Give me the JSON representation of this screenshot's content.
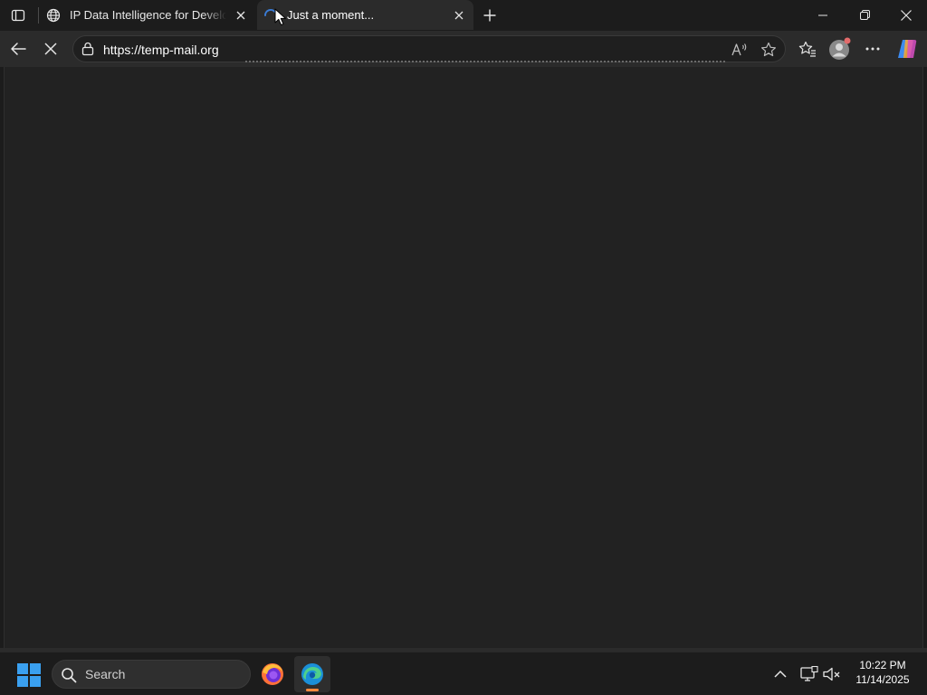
{
  "browser": {
    "tabs": [
      {
        "title": "IP Data Intelligence for Developers",
        "icon": "globe-icon",
        "active": false
      },
      {
        "title": "Just a moment...",
        "icon": "loading-spinner-icon",
        "active": true
      }
    ],
    "url": "https://temp-mail.org",
    "toolbar_icons": [
      "back-icon",
      "stop-loading-icon",
      "lock-icon",
      "read-aloud-icon",
      "favorite-star-icon",
      "favorites-icon",
      "profile-icon",
      "more-icon",
      "copilot-icon"
    ],
    "window_controls": [
      "minimize-icon",
      "restore-icon",
      "close-icon"
    ],
    "colors": {
      "titlebar": "#1c1c1c",
      "toolbar": "#2b2b2b",
      "page": "#222222",
      "accent_running": "#ff8a3d",
      "spinner": "#3a7bd5"
    }
  },
  "taskbar": {
    "search_label": "Search",
    "apps": [
      {
        "name": "Firefox",
        "icon": "firefox-icon",
        "active": false
      },
      {
        "name": "Microsoft Edge",
        "icon": "edge-icon",
        "active": true
      }
    ],
    "tray_icons": [
      "show-hidden-icons-chevron",
      "display-icon",
      "volume-muted-icon"
    ],
    "time": "10:22 PM",
    "date": "11/14/2025"
  }
}
